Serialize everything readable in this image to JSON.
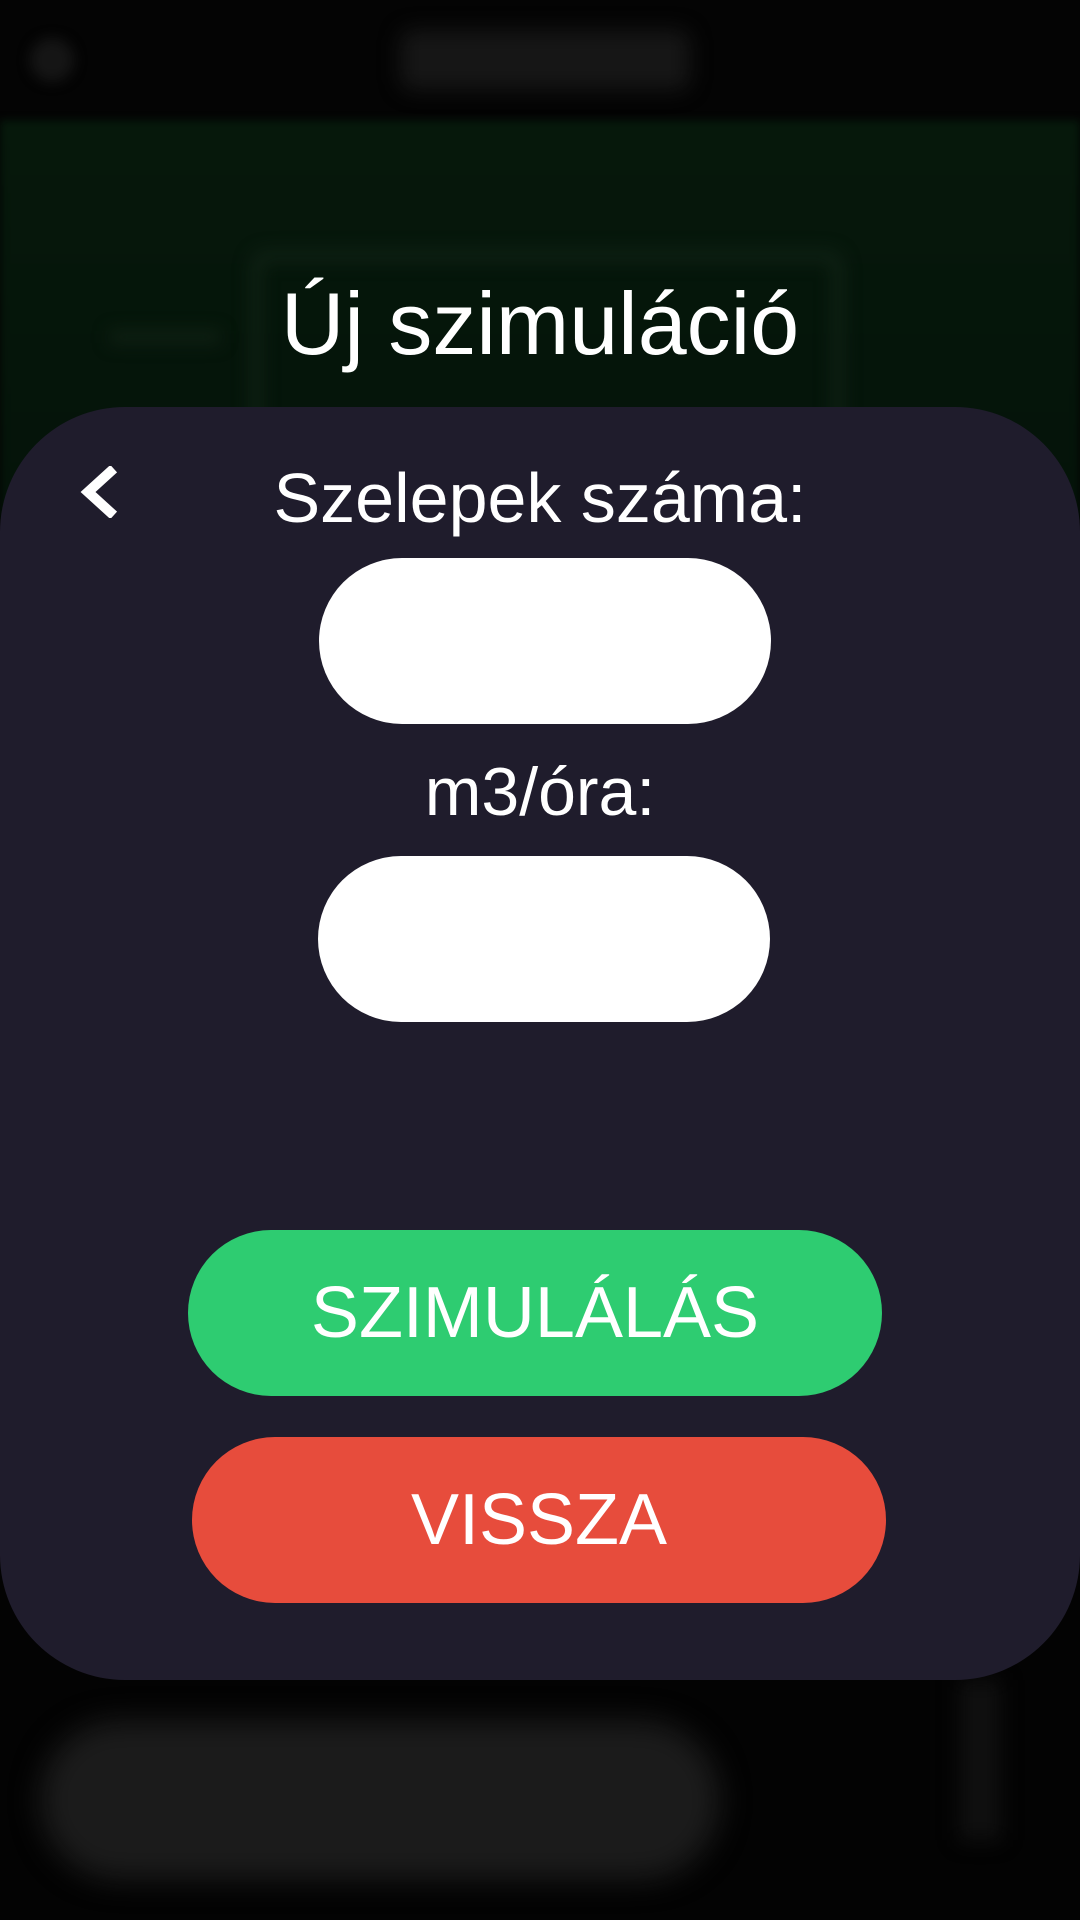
{
  "dialog": {
    "title": "Új szimuláció"
  },
  "form": {
    "valves_label": "Szelepek száma:",
    "valves_value": "",
    "flow_label": "m3/óra:",
    "flow_value": ""
  },
  "buttons": {
    "simulate_label": "SZIMULÁLÁS",
    "back_label": "VISSZA"
  },
  "icons": {
    "back": "chevron-left-icon"
  },
  "colors": {
    "card_background": "#1f1c2c",
    "simulate_button": "#2ecc71",
    "back_button": "#e74c3c",
    "input_background": "#ffffff",
    "text": "#ffffff"
  }
}
